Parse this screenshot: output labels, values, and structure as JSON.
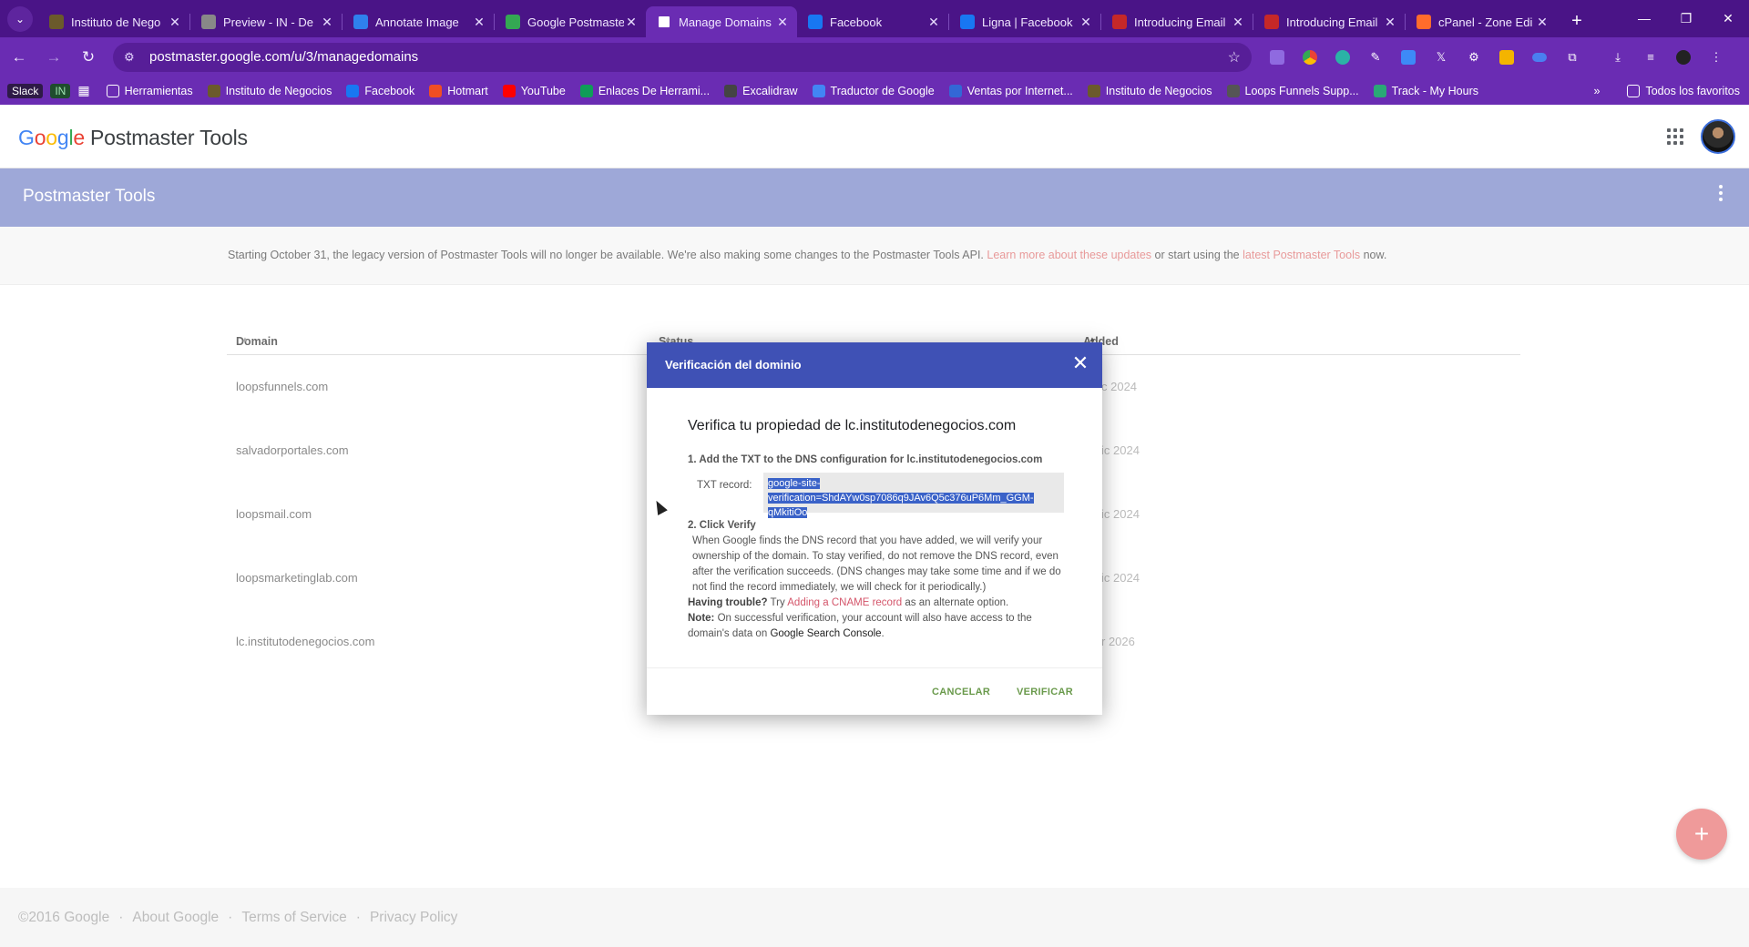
{
  "browser": {
    "tabs": [
      {
        "title": "Instituto de Nego",
        "icon_color": "#6b5a2b",
        "icon": "tree-icon"
      },
      {
        "title": "Preview - IN - De",
        "icon_color": "#888888",
        "icon": "globe-icon"
      },
      {
        "title": "Annotate Image",
        "icon_color": "#2f80ed",
        "icon": "chrome-icon"
      },
      {
        "title": "Google Postmaste",
        "icon_color": "#34a853",
        "icon": "chatgpt-icon"
      },
      {
        "title": "Manage Domains",
        "icon_color": "#ffffff",
        "icon": "postmaster-icon"
      },
      {
        "title": "Facebook",
        "icon_color": "#1877f2",
        "icon": "facebook-icon"
      },
      {
        "title": "Ligna | Facebook",
        "icon_color": "#1877f2",
        "icon": "facebook-icon"
      },
      {
        "title": "Introducing Email",
        "icon_color": "#c62828",
        "icon": "doc-icon"
      },
      {
        "title": "Introducing Email",
        "icon_color": "#c62828",
        "icon": "doc-icon"
      },
      {
        "title": "cPanel - Zone Edi",
        "icon_color": "#ff6c2c",
        "icon": "cpanel-icon"
      }
    ],
    "url": "postmaster.google.com/u/3/managedomains"
  },
  "bookmarks": {
    "chips": [
      "Slack",
      "IN"
    ],
    "items": [
      {
        "label": "Herramientas",
        "icon": "folder-icon",
        "color": "#d9cfff"
      },
      {
        "label": "Instituto de Negocios",
        "icon": "tree-icon",
        "color": "#6b5a2b"
      },
      {
        "label": "Facebook",
        "icon": "facebook-icon",
        "color": "#1877f2"
      },
      {
        "label": "Hotmart",
        "icon": "flame-icon",
        "color": "#f04e23"
      },
      {
        "label": "YouTube",
        "icon": "youtube-icon",
        "color": "#ff0000"
      },
      {
        "label": "Enlaces De Herrami...",
        "icon": "sheets-icon",
        "color": "#0f9d58"
      },
      {
        "label": "Excalidraw",
        "icon": "excalidraw-icon",
        "color": "#444444"
      },
      {
        "label": "Traductor de Google",
        "icon": "translate-icon",
        "color": "#4285f4"
      },
      {
        "label": "Ventas por Internet...",
        "icon": "pen-icon",
        "color": "#3367d6"
      },
      {
        "label": "Instituto de Negocios",
        "icon": "tree-icon",
        "color": "#6b5a2b"
      },
      {
        "label": "Loops Funnels Supp...",
        "icon": "loop-icon",
        "color": "#555555"
      },
      {
        "label": "Track - My Hours",
        "icon": "clock-icon",
        "color": "#2aa876"
      }
    ],
    "all_favorites": "Todos los favoritos"
  },
  "app": {
    "logo_google": "Google",
    "logo_product": "Postmaster Tools",
    "subheader_title": "Postmaster Tools",
    "notice": {
      "text1": "Starting October 31, the legacy version of Postmaster Tools will no longer be available. We're also making some changes to the Postmaster Tools API. ",
      "link1": "Learn more about these updates",
      "text2": " or start using the ",
      "link2": "latest Postmaster Tools",
      "text3": " now."
    }
  },
  "table": {
    "columns": {
      "domain": "Domain",
      "status": "Status",
      "added": "Added"
    },
    "rows": [
      {
        "domain": "loopsfunnels.com",
        "added_partial": "c 2024"
      },
      {
        "domain": "salvadorportales.com",
        "added_partial": "ic 2024"
      },
      {
        "domain": "loopsmail.com",
        "added_partial": "ic 2024"
      },
      {
        "domain": "loopsmarketinglab.com",
        "added_partial": "ic 2024"
      },
      {
        "domain": "lc.institutodenegocios.com",
        "added_partial": "r 2026"
      }
    ]
  },
  "dialog": {
    "title": "Verificación del dominio",
    "heading": "Verifica tu propiedad de lc.institutodenegocios.com",
    "step1": "1. Add the TXT to the DNS configuration for lc.institutodenegocios.com",
    "txt_label": "TXT record:",
    "txt_value": "google-site-verification=ShdAYw0sp7086q9JAv6Q5c376uP6Mm_GGM-qMkitiOo",
    "step2": "2. Click Verify",
    "description": "When Google finds the DNS record that you have added, we will verify your ownership of the domain. To stay verified, do not remove the DNS record, even after the verification succeeds. (DNS changes may take some time and if we do not find the record immediately, we will check for it periodically.)",
    "trouble_label": "Having trouble?",
    "trouble_text1": " Try ",
    "trouble_link": "Adding a CNAME record",
    "trouble_text2": " as an alternate option.",
    "note_label": "Note:",
    "note_text": " On successful verification, your account will also have access to the domain's data on ",
    "note_link": "Google Search Console",
    "note_end": ".",
    "cancel": "CANCELAR",
    "verify": "VERIFICAR"
  },
  "footer": {
    "copyright": "©2016 Google",
    "about": "About Google",
    "terms": "Terms of Service",
    "privacy": "Privacy Policy"
  },
  "fab": "+"
}
